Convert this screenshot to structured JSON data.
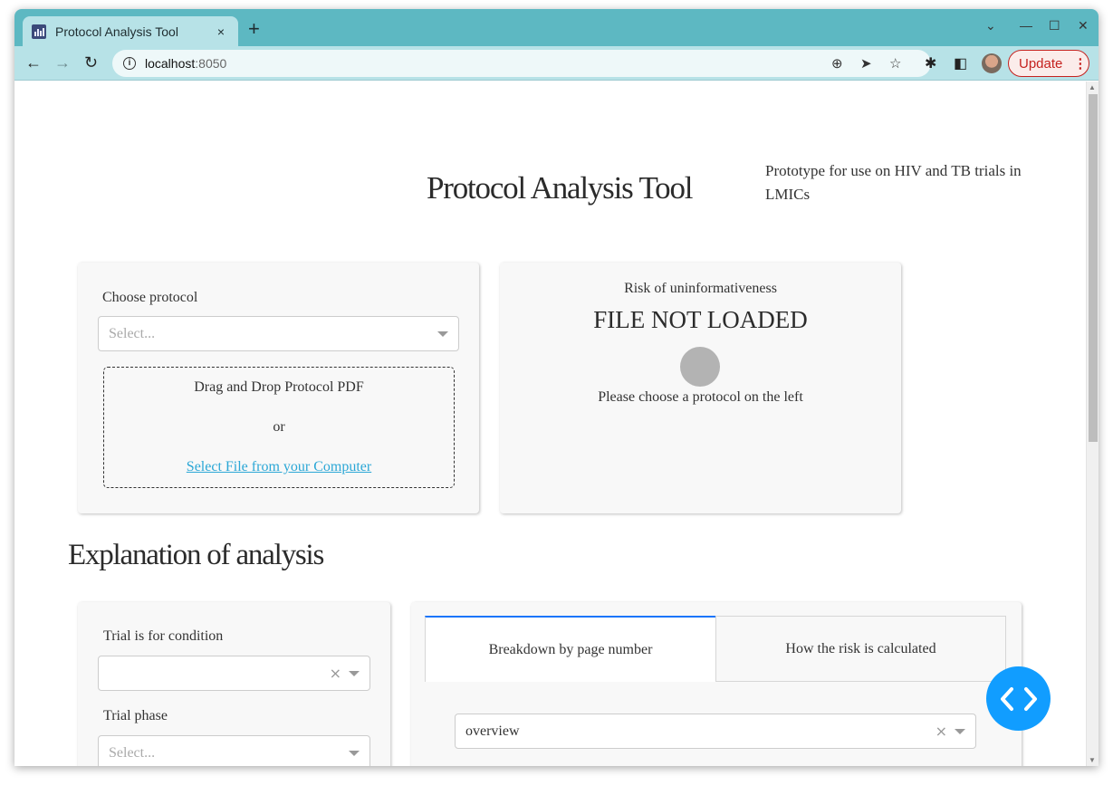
{
  "browser": {
    "tab_title": "Protocol Analysis Tool",
    "url_host": "localhost",
    "url_port": ":8050",
    "update_label": "Update",
    "icons": {
      "tab_close": "×",
      "new_tab": "+",
      "tab_search": "⌄",
      "minimize": "—",
      "maximize": "☐",
      "close": "✕",
      "back": "←",
      "forward": "→",
      "reload": "↻",
      "zoom": "⊕",
      "send": "➤",
      "bookmark": "☆",
      "extensions": "✱",
      "side_panel": "◧",
      "menu": "⋮"
    }
  },
  "header": {
    "title": "Protocol Analysis Tool",
    "subtitle": "Prototype for use on HIV and TB trials in LMICs"
  },
  "protocol_card": {
    "label": "Choose protocol",
    "dropdown_placeholder": "Select...",
    "upload": {
      "line1": "Drag and Drop Protocol PDF",
      "line2": "or",
      "link": "Select File from your Computer"
    }
  },
  "risk_card": {
    "heading": "Risk of uninformativeness",
    "status": "FILE NOT LOADED",
    "indicator_color": "#b3b3b3",
    "message": "Please choose a protocol on the left"
  },
  "explanation": {
    "title": "Explanation of analysis",
    "filters": {
      "condition_label": "Trial is for condition",
      "condition_value": "",
      "phase_label": "Trial phase",
      "phase_placeholder": "Select..."
    },
    "tabs": [
      {
        "label": "Breakdown by page number",
        "active": true
      },
      {
        "label": "How the risk is calculated",
        "active": false
      }
    ],
    "view_dropdown_value": "overview"
  },
  "colors": {
    "accent": "#1975fa",
    "link": "#2ba7d6",
    "fab": "#119dff",
    "browser_frame": "#5db8c2"
  }
}
